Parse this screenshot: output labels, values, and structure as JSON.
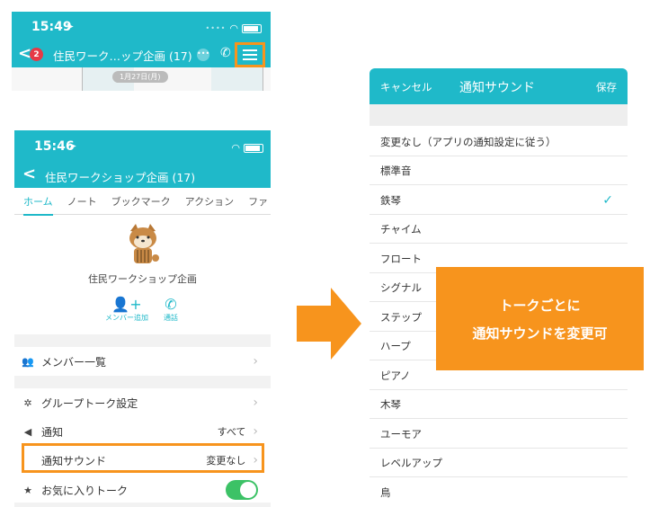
{
  "screen_top": {
    "status_time": "15:49",
    "back_badge": "2",
    "chat_title": "住民ワーク…ップ企画 (17)",
    "date_pill": "1月27日(月)"
  },
  "screen_bottom": {
    "status_time": "15:46",
    "header_title": "住民ワークショップ企画 (17)",
    "tabs": [
      "ホーム",
      "ノート",
      "ブックマーク",
      "アクション",
      "ファ"
    ],
    "group_name": "住民ワークショップ企画",
    "actions": [
      {
        "label": "メンバー追加",
        "icon": "add-member-icon"
      },
      {
        "label": "通話",
        "icon": "phone-icon"
      }
    ],
    "rows": {
      "members": {
        "label": "メンバー一覧"
      },
      "group_settings": {
        "label": "グループトーク設定"
      },
      "notify": {
        "label": "通知",
        "value": "すべて"
      },
      "notify_sound": {
        "label": "通知サウンド",
        "value": "変更なし"
      },
      "favorite": {
        "label": "お気に入りトーク",
        "toggle_on": true
      }
    }
  },
  "screen_right": {
    "cancel": "キャンセル",
    "title": "通知サウンド",
    "save": "保存",
    "options": [
      "変更なし（アプリの通知設定に従う）",
      "標準音",
      "鉄琴",
      "チャイム",
      "フロート",
      "シグナル",
      "ステップ",
      "ハープ",
      "ピアノ",
      "木琴",
      "ユーモア",
      "レベルアップ",
      "鳥"
    ],
    "selected_index": 2
  },
  "callout": {
    "line1": "トークごとに",
    "line2": "通知サウンドを変更可"
  },
  "colors": {
    "accent": "#1fb9c9",
    "highlight": "#f7941d",
    "toggle": "#3cc266"
  }
}
